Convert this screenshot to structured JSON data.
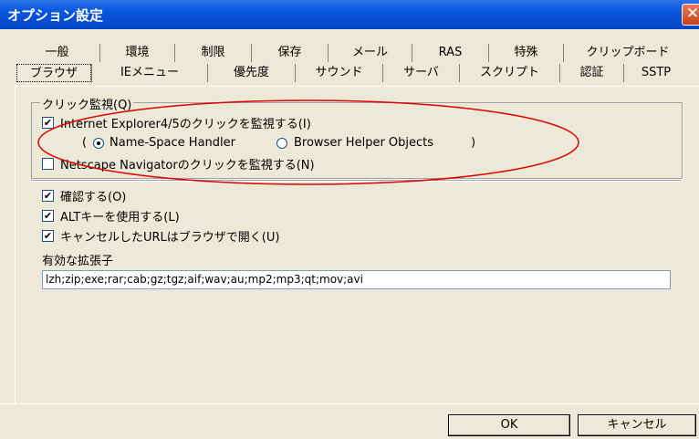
{
  "window": {
    "title": "オプション設定",
    "close_glyph": "✕"
  },
  "tabs": {
    "row1": [
      "一般",
      "環境",
      "制限",
      "保存",
      "メール",
      "RAS",
      "特殊",
      "クリップボード"
    ],
    "row2": [
      "ブラウザ",
      "IEメニュー",
      "優先度",
      "サウンド",
      "サーバ",
      "スクリプト",
      "認証",
      "SSTP"
    ],
    "active": "ブラウザ"
  },
  "click_monitor": {
    "group_label": "クリック監視(Q)",
    "ie_checkbox": {
      "label": "Internet Explorer4/5のクリックを監視する(I)",
      "checked": true
    },
    "handler_open": "(",
    "handler_close": ")",
    "radio_namespace": {
      "label": "Name-Space Handler",
      "selected": true
    },
    "radio_bho": {
      "label": "Browser Helper Objects",
      "selected": false
    },
    "netscape_checkbox": {
      "label": "Netscape Navigatorのクリックを監視する(N)",
      "checked": false
    }
  },
  "options": {
    "confirm": {
      "label": "確認する(O)",
      "checked": true
    },
    "alt_key": {
      "label": "ALTキーを使用する(L)",
      "checked": true
    },
    "cancel_url": {
      "label": "キャンセルしたURLはブラウザで開く(U)",
      "checked": true
    }
  },
  "extensions": {
    "label": "有効な拡張子",
    "value": "lzh;zip;exe;rar;cab;gz;tgz;aif;wav;au;mp2;mp3;qt;mov;avi"
  },
  "buttons": {
    "ok": "OK",
    "cancel": "キャンセル"
  },
  "colors": {
    "titlebar": "#0855dd",
    "annotation": "#e00000",
    "dialog_bg": "#ece9d8"
  },
  "check_glyph": "✔"
}
